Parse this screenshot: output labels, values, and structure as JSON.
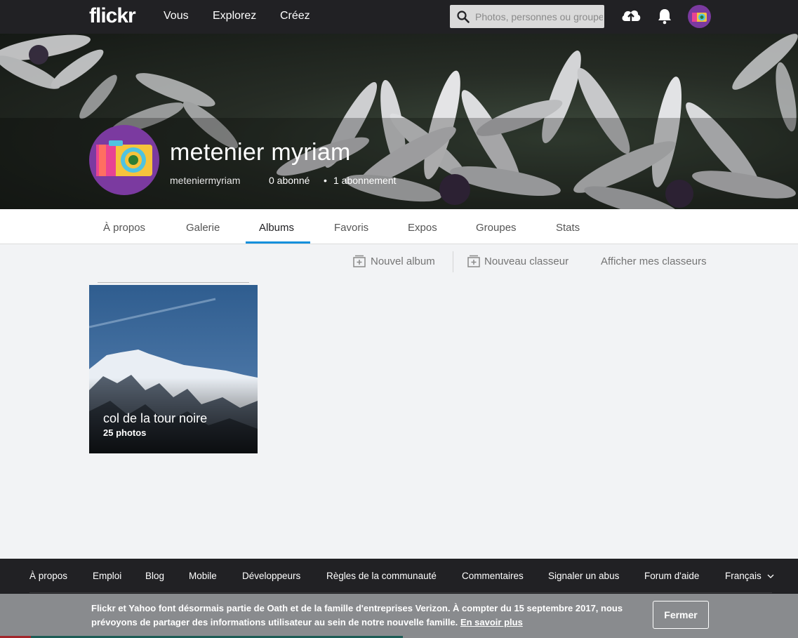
{
  "topbar": {
    "logo": "flickr",
    "nav": [
      "Vous",
      "Explorez",
      "Créez"
    ],
    "search_placeholder": "Photos, personnes ou groupes"
  },
  "profile": {
    "name": "metenier myriam",
    "username": "meteniermyriam",
    "followers": "0 abonné",
    "separator": "•",
    "following": "1 abonnement"
  },
  "tabs": [
    "À propos",
    "Galerie",
    "Albums",
    "Favoris",
    "Expos",
    "Groupes",
    "Stats"
  ],
  "active_tab": "Albums",
  "actions": {
    "new_album": "Nouvel album",
    "new_collection": "Nouveau classeur",
    "show_collections": "Afficher mes classeurs"
  },
  "albums": [
    {
      "title": "col de la tour noire",
      "count": "25 photos"
    }
  ],
  "footer": {
    "links": [
      "À propos",
      "Emploi",
      "Blog",
      "Mobile",
      "Développeurs",
      "Règles de la communauté",
      "Commentaires",
      "Signaler un abus",
      "Forum d'aide",
      "Français"
    ]
  },
  "notice": {
    "text": "Flickr et Yahoo font désormais partie de Oath et de la famille d'entreprises Verizon. À compter du 15 septembre 2017, nous prévoyons de partager des informations utilisateur au sein de notre nouvelle famille.",
    "link": "En savoir plus",
    "close_label": "Fermer"
  },
  "colors": {
    "topbar": "#212124",
    "accent": "#128fdc",
    "avatar_bg": "#7b3aa0",
    "notice_bg": "#898b8e"
  },
  "icons": [
    "search-icon",
    "upload-cloud-icon",
    "bell-icon",
    "new-album-icon",
    "new-collection-icon",
    "chevron-down-icon"
  ]
}
